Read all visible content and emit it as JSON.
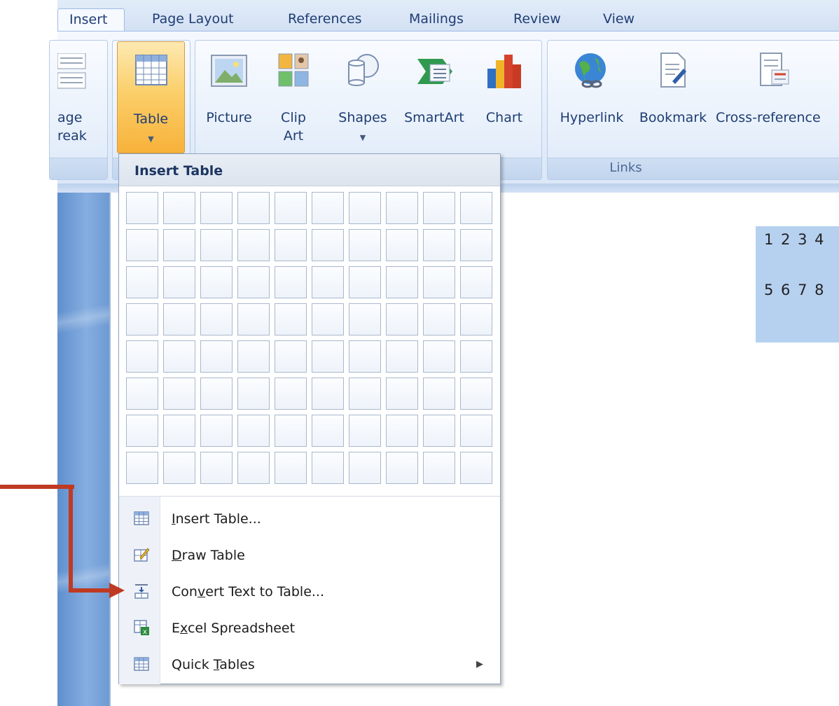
{
  "tabs": [
    {
      "label": "Insert",
      "active": true
    },
    {
      "label": "Page Layout",
      "active": false
    },
    {
      "label": "References",
      "active": false
    },
    {
      "label": "Mailings",
      "active": false
    },
    {
      "label": "Review",
      "active": false
    },
    {
      "label": "View",
      "active": false
    }
  ],
  "ribbon": {
    "page_break": {
      "line1": "age",
      "line2": "reak"
    },
    "table": {
      "label": "Table",
      "icon": "table-icon"
    },
    "picture": {
      "label": "Picture",
      "icon": "picture-icon"
    },
    "clip_art": {
      "line1": "Clip",
      "line2": "Art",
      "icon": "clip-art-icon"
    },
    "shapes": {
      "label": "Shapes",
      "icon": "shapes-icon"
    },
    "smartart": {
      "label": "SmartArt",
      "icon": "smartart-icon"
    },
    "chart": {
      "label": "Chart",
      "icon": "chart-icon"
    },
    "hyperlink": {
      "label": "Hyperlink",
      "icon": "hyperlink-icon"
    },
    "bookmark": {
      "label": "Bookmark",
      "icon": "bookmark-icon"
    },
    "cross_reference": {
      "label": "Cross-reference",
      "icon": "cross-reference-icon"
    },
    "links_group_label": "Links"
  },
  "dropdown": {
    "header": "Insert Table",
    "grid": {
      "rows": 8,
      "cols": 10
    },
    "menu_items": [
      {
        "pre": "",
        "key": "I",
        "post": "nsert Table...",
        "icon": "insert-table-icon"
      },
      {
        "pre": "",
        "key": "D",
        "post": "raw Table",
        "icon": "draw-table-icon"
      },
      {
        "pre": "Con",
        "key": "v",
        "post": "ert Text to Table...",
        "icon": "convert-text-to-table-icon"
      },
      {
        "pre": "E",
        "key": "x",
        "post": "cel Spreadsheet",
        "icon": "excel-spreadsheet-icon"
      },
      {
        "pre": "Quick ",
        "key": "T",
        "post": "ables",
        "icon": "quick-tables-icon",
        "submenu": true
      }
    ]
  },
  "document": {
    "lines": [
      "1 2 3 4",
      "5 6 7 8"
    ]
  },
  "colors": {
    "annotation_arrow": "#bf3a22",
    "selected_button": "#f7b23a",
    "ribbon": "#dbe7f7"
  }
}
